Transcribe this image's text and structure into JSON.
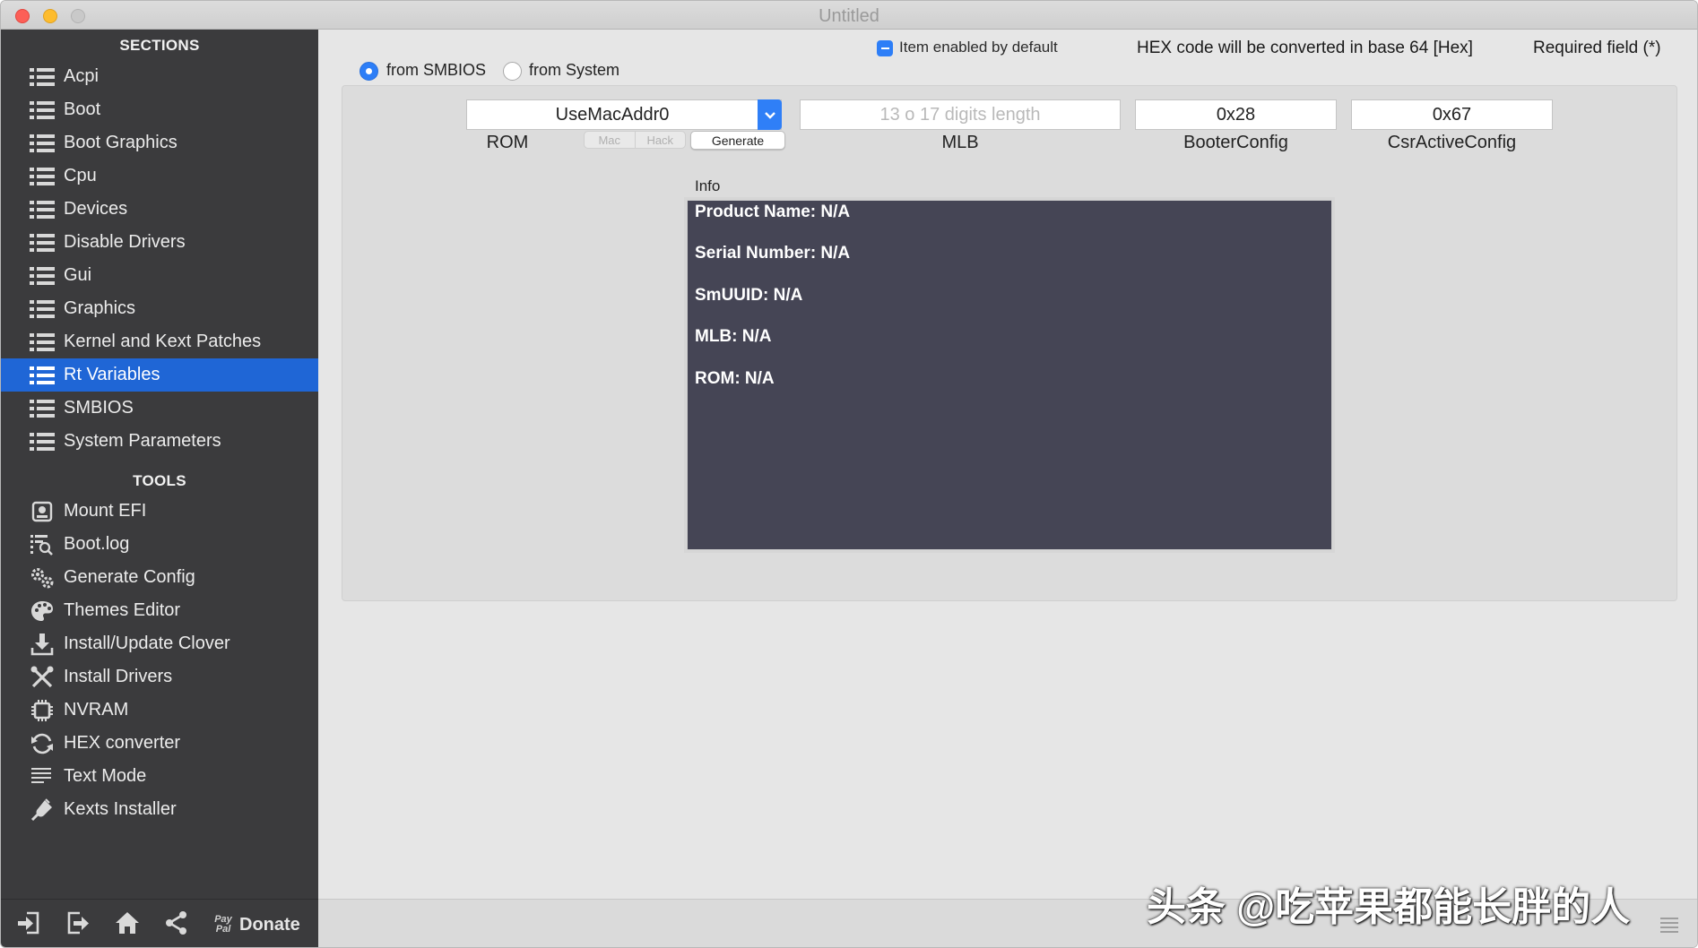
{
  "window": {
    "title": "Untitled"
  },
  "sidebar": {
    "sections_header": "SECTIONS",
    "sections": [
      {
        "label": "Acpi",
        "icon": "list-icon"
      },
      {
        "label": "Boot",
        "icon": "list-icon"
      },
      {
        "label": "Boot Graphics",
        "icon": "list-icon"
      },
      {
        "label": "Cpu",
        "icon": "list-icon"
      },
      {
        "label": "Devices",
        "icon": "list-icon"
      },
      {
        "label": "Disable Drivers",
        "icon": "list-icon"
      },
      {
        "label": "Gui",
        "icon": "list-icon"
      },
      {
        "label": "Graphics",
        "icon": "list-icon"
      },
      {
        "label": "Kernel and Kext Patches",
        "icon": "list-icon"
      },
      {
        "label": "Rt Variables",
        "icon": "list-icon",
        "selected": true
      },
      {
        "label": "SMBIOS",
        "icon": "list-icon"
      },
      {
        "label": "System Parameters",
        "icon": "list-icon"
      }
    ],
    "tools_header": "TOOLS",
    "tools": [
      {
        "label": "Mount EFI",
        "icon": "disk-icon"
      },
      {
        "label": "Boot.log",
        "icon": "log-search-icon"
      },
      {
        "label": "Generate Config",
        "icon": "gears-icon"
      },
      {
        "label": "Themes Editor",
        "icon": "palette-icon"
      },
      {
        "label": "Install/Update Clover",
        "icon": "download-icon"
      },
      {
        "label": "Install Drivers",
        "icon": "tools-icon"
      },
      {
        "label": "NVRAM",
        "icon": "chip-icon"
      },
      {
        "label": "HEX converter",
        "icon": "refresh-icon"
      },
      {
        "label": "Text Mode",
        "icon": "text-lines-icon"
      },
      {
        "label": "Kexts Installer",
        "icon": "plug-icon"
      }
    ],
    "bottom": {
      "donate_label": "Donate",
      "paypal_mark": "Pay Pal"
    }
  },
  "header": {
    "item_enabled_label": "Item enabled by default",
    "hex_note": "HEX code will be converted in base 64 [Hex]",
    "required_note": "Required field (*)"
  },
  "source": {
    "option_smbios": "from SMBIOS",
    "option_system": "from System",
    "selected": "from SMBIOS"
  },
  "fields": {
    "rom": {
      "value": "UseMacAddr0",
      "label": "ROM"
    },
    "mlb": {
      "placeholder": "13 o 17 digits length",
      "label": "MLB"
    },
    "booter_config": {
      "value": "0x28",
      "label": "BooterConfig"
    },
    "csr_active_config": {
      "value": "0x67",
      "label": "CsrActiveConfig"
    }
  },
  "generator": {
    "mac_label": "Mac",
    "hack_label": "Hack",
    "generate_label": "Generate"
  },
  "info": {
    "title": "Info",
    "lines": [
      "Product Name: N/A",
      "Serial Number: N/A",
      "SmUUID: N/A",
      "MLB: N/A",
      "ROM: N/A"
    ]
  },
  "watermark": "头条 @吃苹果都能长胖的人",
  "colors": {
    "sidebar_bg": "#3b3b3d",
    "selection": "#1f66d6",
    "accent": "#2d7ef7",
    "info_bg": "#454555"
  }
}
